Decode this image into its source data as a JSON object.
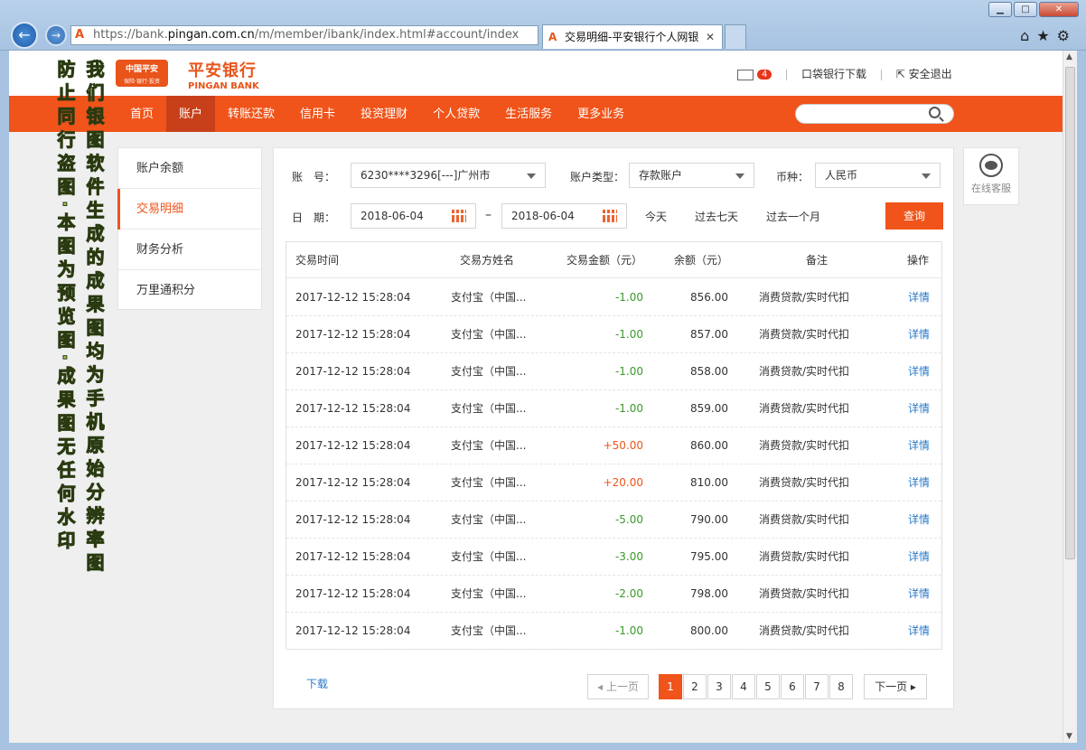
{
  "browser": {
    "url_prefix": "https://bank.",
    "url_domain": "pingan.com.cn",
    "url_path": "/m/member/ibank/index.html#account/index",
    "tab_title": "交易明细-平安银行个人网银",
    "tab_logo": "A",
    "tools": "⌕ ▾ ↻ ▾",
    "right_tools": "⌂★⚙",
    "win_min": "▁",
    "win_max": "□",
    "win_close": "✕",
    "back": "←",
    "forward": "→",
    "tab_close": "✕"
  },
  "header": {
    "logo_box": "中国平安",
    "logo_box_small": "保险·银行·投资",
    "brand_cn": "平安银行",
    "brand_en": "PINGAN BANK",
    "mail_count": "4",
    "app_download": "口袋银行下载",
    "logout": "安全退出",
    "logout_icon": "⇱"
  },
  "nav": {
    "items": [
      "首页",
      "账户",
      "转账还款",
      "信用卡",
      "投资理财",
      "个人贷款",
      "生活服务",
      "更多业务"
    ],
    "active": 1
  },
  "sidebar": {
    "items": [
      "账户余额",
      "交易明细",
      "财务分析",
      "万里通积分"
    ],
    "active": 1
  },
  "filters": {
    "account_label": "账　号：",
    "account_value": "6230****3296[---]广州市",
    "acct_type_label": "账户类型：",
    "acct_type_value": "存款账户",
    "currency_label": "币种：",
    "currency_value": "人民币",
    "date_label": "日　期：",
    "date_from": "2018-06-04",
    "date_sep": "–",
    "date_to": "2018-06-04",
    "quick": [
      "今天",
      "过去七天",
      "过去一个月"
    ],
    "query_btn": "查询"
  },
  "table": {
    "headers": [
      "交易时间",
      "交易方姓名",
      "交易金额（元）",
      "余额（元）",
      "备注",
      "操作"
    ],
    "rows": [
      {
        "time": "2017-12-12 15:28:04",
        "party": "支付宝（中国...",
        "amount": "-1.00",
        "balance": "856.00",
        "note": "消费贷款/实时代扣",
        "op": "详情",
        "sign": "neg"
      },
      {
        "time": "2017-12-12 15:28:04",
        "party": "支付宝（中国...",
        "amount": "-1.00",
        "balance": "857.00",
        "note": "消费贷款/实时代扣",
        "op": "详情",
        "sign": "neg"
      },
      {
        "time": "2017-12-12 15:28:04",
        "party": "支付宝（中国...",
        "amount": "-1.00",
        "balance": "858.00",
        "note": "消费贷款/实时代扣",
        "op": "详情",
        "sign": "neg"
      },
      {
        "time": "2017-12-12 15:28:04",
        "party": "支付宝（中国...",
        "amount": "-1.00",
        "balance": "859.00",
        "note": "消费贷款/实时代扣",
        "op": "详情",
        "sign": "neg"
      },
      {
        "time": "2017-12-12 15:28:04",
        "party": "支付宝（中国...",
        "amount": "+50.00",
        "balance": "860.00",
        "note": "消费贷款/实时代扣",
        "op": "详情",
        "sign": "pos"
      },
      {
        "time": "2017-12-12 15:28:04",
        "party": "支付宝（中国...",
        "amount": "+20.00",
        "balance": "810.00",
        "note": "消费贷款/实时代扣",
        "op": "详情",
        "sign": "pos"
      },
      {
        "time": "2017-12-12 15:28:04",
        "party": "支付宝（中国...",
        "amount": "-5.00",
        "balance": "790.00",
        "note": "消费贷款/实时代扣",
        "op": "详情",
        "sign": "neg"
      },
      {
        "time": "2017-12-12 15:28:04",
        "party": "支付宝（中国...",
        "amount": "-3.00",
        "balance": "795.00",
        "note": "消费贷款/实时代扣",
        "op": "详情",
        "sign": "neg"
      },
      {
        "time": "2017-12-12 15:28:04",
        "party": "支付宝（中国...",
        "amount": "-2.00",
        "balance": "798.00",
        "note": "消费贷款/实时代扣",
        "op": "详情",
        "sign": "neg"
      },
      {
        "time": "2017-12-12 15:28:04",
        "party": "支付宝（中国...",
        "amount": "-1.00",
        "balance": "800.00",
        "note": "消费贷款/实时代扣",
        "op": "详情",
        "sign": "neg"
      }
    ]
  },
  "download": "下载",
  "pagination": {
    "prev": "◂ 上一页",
    "pages": [
      "1",
      "2",
      "3",
      "4",
      "5",
      "6",
      "7",
      "8"
    ],
    "active": 0,
    "next": "下一页 ▸"
  },
  "chat": {
    "label": "在线客服"
  },
  "watermark": {
    "col1": "防止同行盗图·本图为预览图·成果图无任何水印",
    "col2": "我们银图软件生成的成果图均为手机原始分辨率图"
  }
}
